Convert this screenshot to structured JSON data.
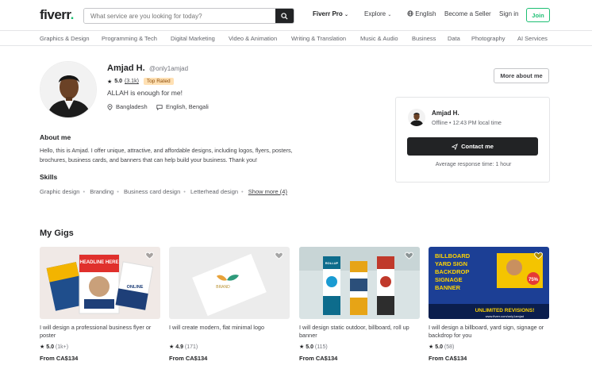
{
  "header": {
    "logo": "fiverr",
    "logo_dot": ".",
    "search_placeholder": "What service are you looking for today?",
    "nav": {
      "pro": "Fiverr Pro",
      "explore": "Explore",
      "language": "English",
      "seller": "Become a Seller",
      "signin": "Sign in",
      "join": "Join"
    }
  },
  "categories": [
    "Graphics & Design",
    "Programming & Tech",
    "Digital Marketing",
    "Video & Animation",
    "Writing & Translation",
    "Music & Audio",
    "Business",
    "Data",
    "Photography",
    "AI Services"
  ],
  "profile": {
    "name": "Amjad H.",
    "username": "@only1amjad",
    "rating": "5.0",
    "review_count": "(3.1k)",
    "badge": "Top Rated",
    "tagline": "ALLAH is enough for me!",
    "country": "Bangladesh",
    "languages": "English, Bengali",
    "more_about": "More about me"
  },
  "contact_card": {
    "name": "Amjad H.",
    "status": "Offline • 12:43 PM local time",
    "button": "Contact me",
    "response": "Average response time: 1 hour"
  },
  "about": {
    "heading": "About me",
    "text": "Hello, this is Amjad. I offer unique, attractive, and affordable designs, including logos, flyers, posters, brochures, business cards, and banners that can help build your business. Thank you!"
  },
  "skills": {
    "heading": "Skills",
    "items": [
      "Graphic design",
      "Branding",
      "Business card design",
      "Letterhead design"
    ],
    "show_more": "Show more (4)"
  },
  "gigs": {
    "heading": "My Gigs",
    "items": [
      {
        "title": "I will design a professional business flyer or poster",
        "rating": "5.0",
        "count": "(1k+)",
        "price": "From CA$134",
        "image_text": [
          "HEADLINE HERE",
          "ONLINE"
        ]
      },
      {
        "title": "I will create modern, flat minimal logo",
        "rating": "4.9",
        "count": "(171)",
        "price": "From CA$134",
        "image_text": [
          "BRAND"
        ]
      },
      {
        "title": "I will design static outdoor, billboard, roll up banner",
        "rating": "5.0",
        "count": "(115)",
        "price": "From CA$134",
        "image_text": [
          "ROLLUP"
        ]
      },
      {
        "title": "I will design a billboard, yard sign, signage or backdrop for you",
        "rating": "5.0",
        "count": "(58)",
        "price": "From CA$134",
        "image_text": [
          "BILLBOARD",
          "YARD SIGN",
          "BACKDROP",
          "SIGNAGE",
          "BANNER",
          "75%",
          "UNLIMITED REVISIONS!",
          "www.fiverr.com/only1amjad"
        ]
      }
    ]
  },
  "colors": {
    "brand_green": "#1dbf73",
    "dark": "#222325",
    "badge_bg": "#ffe0b3"
  }
}
